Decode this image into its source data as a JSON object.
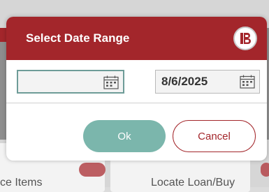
{
  "dialog": {
    "title": "Select Date Range",
    "start_date": {
      "value": "",
      "placeholder": ""
    },
    "end_date": {
      "value": "8/6/2025",
      "placeholder": ""
    },
    "ok_label": "Ok",
    "cancel_label": "Cancel"
  },
  "background": {
    "left_tile_label": "ce Items",
    "right_tile_label": "Locate Loan/Buy"
  },
  "colors": {
    "brand": "#a3262b",
    "ok_button": "#7bb6ac",
    "focus_border": "#6e9c98"
  },
  "icons": {
    "logo": "brand-logo-icon",
    "calendar": "calendar-icon"
  }
}
